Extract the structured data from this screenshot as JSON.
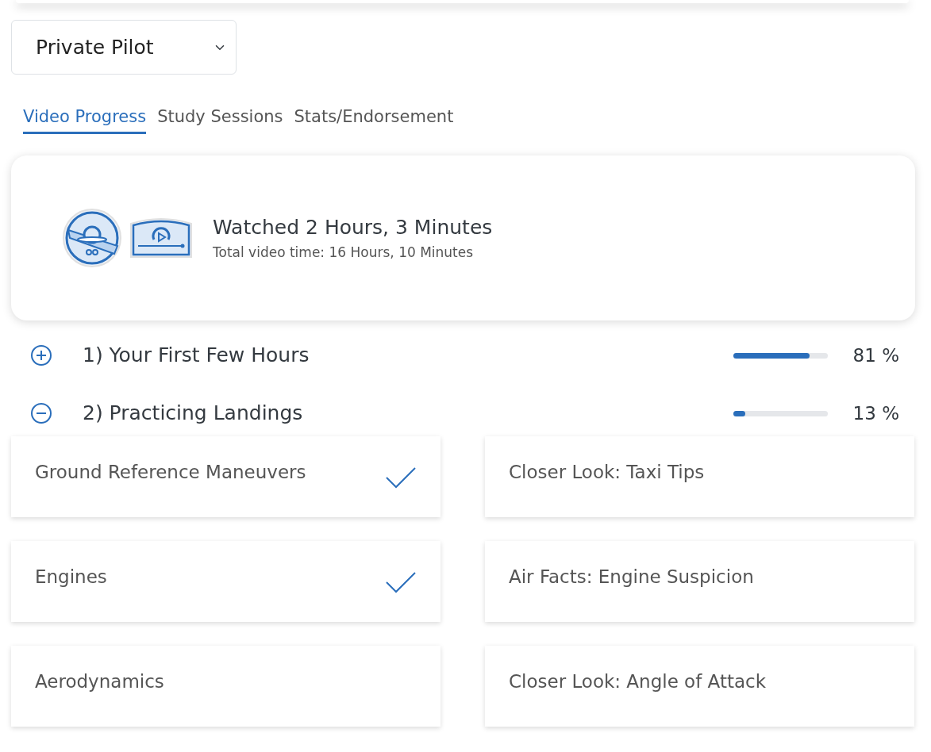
{
  "course_select": {
    "value": "Private Pilot"
  },
  "tabs": [
    {
      "label": "Video Progress",
      "selected": true
    },
    {
      "label": "Study Sessions",
      "selected": false
    },
    {
      "label": "Stats/Endorsement",
      "selected": false
    }
  ],
  "summary": {
    "title": "Watched 2 Hours, 3 Minutes",
    "subtitle": "Total video time: 16 Hours, 10 Minutes"
  },
  "sections": [
    {
      "title": "1) Your First Few Hours",
      "expanded": false,
      "level": 0.81,
      "percent": "81 %"
    },
    {
      "title": "2) Practicing Landings",
      "expanded": true,
      "level": 0.13,
      "percent": "13 %",
      "lessons": [
        {
          "title": "Ground Reference Maneuvers",
          "completed": true
        },
        {
          "title": "Closer Look: Taxi Tips",
          "completed": false
        },
        {
          "title": "Engines",
          "completed": true
        },
        {
          "title": "Air Facts: Engine Suspicion",
          "completed": false
        },
        {
          "title": "Aerodynamics",
          "completed": false
        },
        {
          "title": "Closer Look: Angle of Attack",
          "completed": false
        }
      ]
    }
  ]
}
